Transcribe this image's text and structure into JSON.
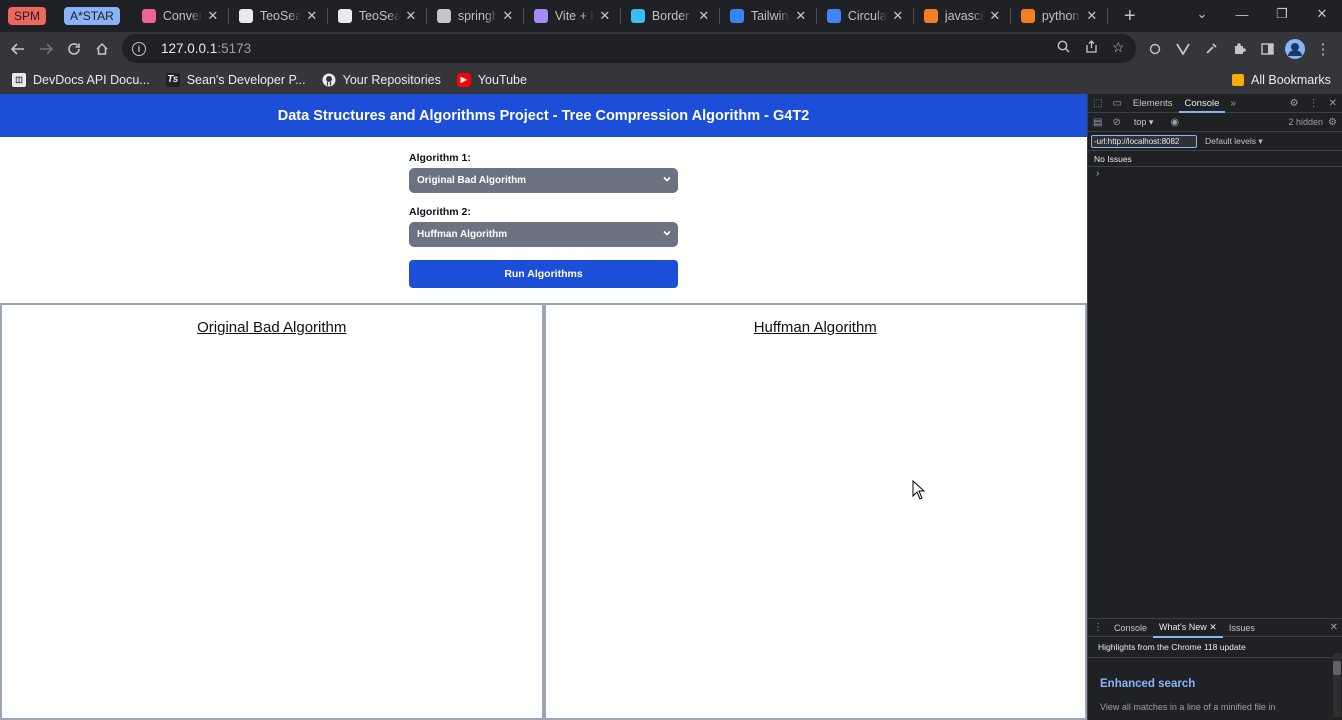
{
  "browser": {
    "tab_groups": [
      {
        "label": "SPM",
        "bg": "#ee675c",
        "fg": "#202124"
      },
      {
        "label": "A*STAR",
        "bg": "#8ab4f8",
        "fg": "#202124"
      }
    ],
    "tabs": [
      {
        "title": "Conventi",
        "favicon": "pink-square-icon",
        "color": "#f06292"
      },
      {
        "title": "TeoSean",
        "favicon": "github-icon",
        "color": "#e8eaed"
      },
      {
        "title": "TeoSean",
        "favicon": "github-icon",
        "color": "#e8eaed"
      },
      {
        "title": "springbo",
        "favicon": "chatgpt-icon",
        "color": "#c4c7c5"
      },
      {
        "title": "Vite + R",
        "favicon": "vite-icon",
        "color": "#a78bfa"
      },
      {
        "title": "Border C",
        "favicon": "tailwind-icon",
        "color": "#38bdf8"
      },
      {
        "title": "Tailwind",
        "favicon": "blue-circle-icon",
        "color": "#3b82f6"
      },
      {
        "title": "Circular",
        "favicon": "confluence-icon",
        "color": "#4285f4"
      },
      {
        "title": "javascri",
        "favicon": "stackoverflow-icon",
        "color": "#f48024"
      },
      {
        "title": "python",
        "favicon": "stackoverflow-icon",
        "color": "#f48024"
      }
    ],
    "url_host": "127.0.0.1",
    "url_port": ":5173",
    "bookmarks": [
      {
        "label": "DevDocs API Docu...",
        "icon": "devdocs-icon"
      },
      {
        "label": "Sean's Developer P...",
        "icon": "ts-icon"
      },
      {
        "label": "Your Repositories",
        "icon": "github-icon"
      },
      {
        "label": "YouTube",
        "icon": "youtube-icon"
      }
    ],
    "all_bookmarks": "All Bookmarks"
  },
  "app": {
    "header_title": "Data Structures and Algorithms Project - Tree Compression Algorithm - G4T2",
    "algorithm1_label": "Algorithm 1:",
    "algorithm1_value": "Original Bad Algorithm",
    "algorithm2_label": "Algorithm 2:",
    "algorithm2_value": "Huffman Algorithm",
    "run_button": "Run Algorithms",
    "panel_left_title": "Original Bad Algorithm",
    "panel_right_title": "Huffman Algorithm"
  },
  "devtools": {
    "tabs": [
      "Elements",
      "Console"
    ],
    "active_tab": "Console",
    "context": "top",
    "hidden_count": "2 hidden",
    "filter_value": "-url:http://localhost:8082",
    "levels": "Default levels",
    "no_issues": "No Issues",
    "drawer_tabs": [
      "Console",
      "What's New",
      "Issues"
    ],
    "drawer_active": "What's New",
    "highlights": "Highlights from the Chrome 118 update",
    "enhanced_title": "Enhanced search",
    "enhanced_text": "View all matches in a line of a minified file in"
  }
}
